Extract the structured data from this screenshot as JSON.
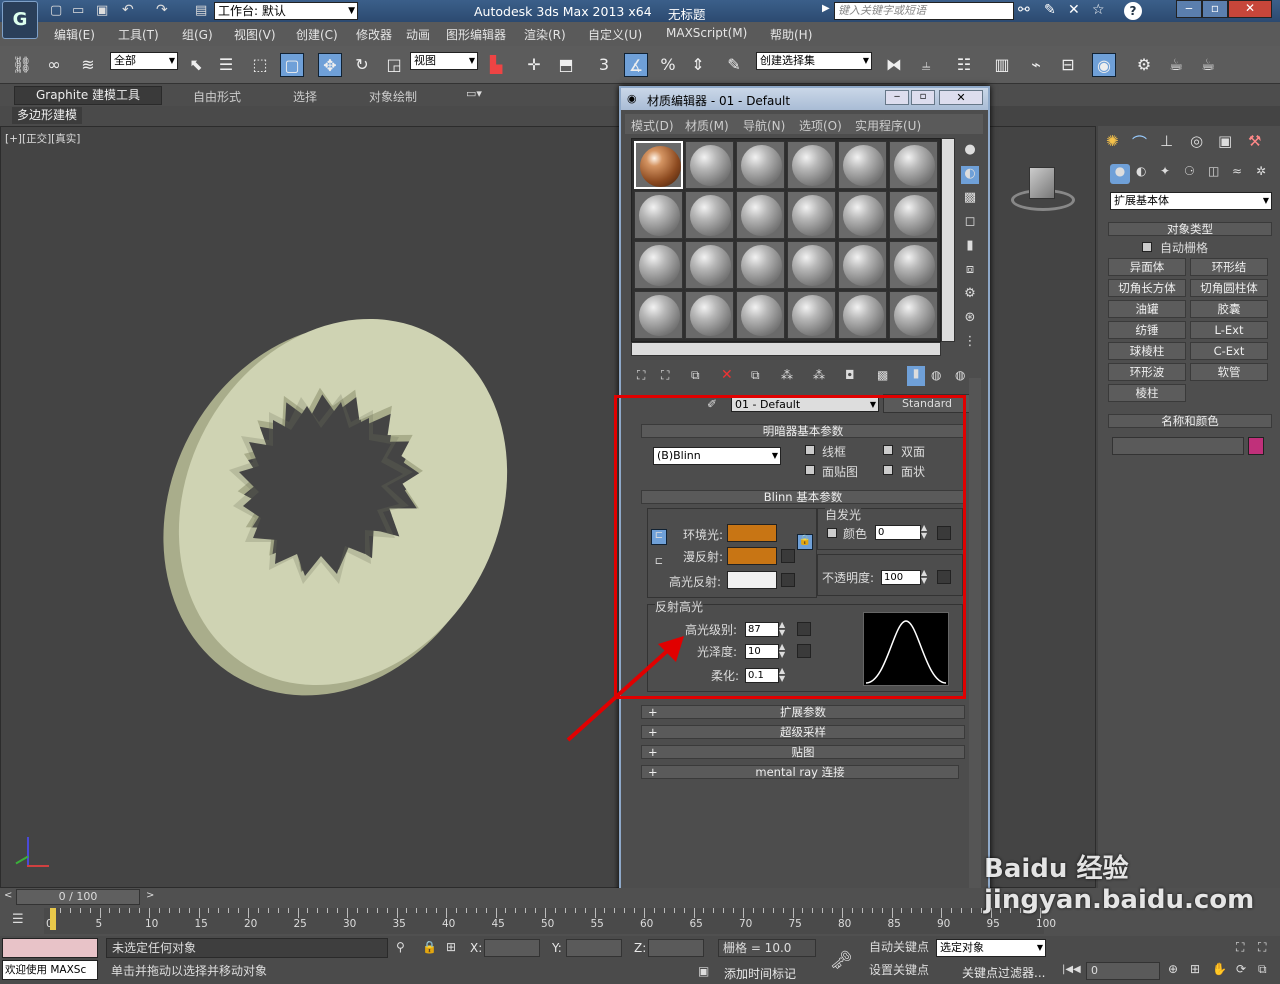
{
  "title_bar": {
    "workspace_label": "工作台: 默认",
    "app_title": "Autodesk 3ds Max  2013 x64",
    "doc_title": "无标题",
    "search_placeholder": "键入关键字或短语"
  },
  "menu": {
    "items": [
      "编辑(E)",
      "工具(T)",
      "组(G)",
      "视图(V)",
      "创建(C)",
      "修改器",
      "动画",
      "图形编辑器",
      "渲染(R)",
      "自定义(U)",
      "MAXScript(M)",
      "帮助(H)"
    ]
  },
  "toolbar": {
    "filter_value": "全部",
    "ref_coord": "视图",
    "selection_set": "创建选择集",
    "snap_label": "3"
  },
  "ribbon": {
    "tabs": [
      "Graphite 建模工具",
      "自由形式",
      "选择",
      "对象绘制"
    ],
    "sub_label": "多边形建模"
  },
  "viewport": {
    "label": "[+][正交][真实]"
  },
  "material_editor": {
    "title": "材质编辑器 - 01 - Default",
    "menu": [
      "模式(D)",
      "材质(M)",
      "导航(N)",
      "选项(O)",
      "实用程序(U)"
    ],
    "material_name": "01 - Default",
    "material_type": "Standard",
    "shader_section": "明暗器基本参数",
    "shader": "(B)Blinn",
    "shader_options": [
      "线框",
      "双面",
      "面贴图",
      "面状"
    ],
    "blinn_section": "Blinn 基本参数",
    "self_illum_label": "自发光",
    "color_label": "颜色",
    "color_value": "0",
    "ambient_label": "环境光:",
    "diffuse_label": "漫反射:",
    "specular_label": "高光反射:",
    "opacity_label": "不透明度:",
    "opacity_value": "100",
    "highlight_section": "反射高光",
    "spec_level_label": "高光级别:",
    "spec_level": "87",
    "gloss_label": "光泽度:",
    "gloss": "10",
    "soften_label": "柔化:",
    "soften": "0.1",
    "rollouts": [
      "扩展参数",
      "超级采样",
      "贴图",
      "mental ray 连接"
    ],
    "colors": {
      "ambient": "#c87514",
      "diffuse": "#c87514",
      "specular": "#f0f0f0"
    }
  },
  "command_panel": {
    "category": "扩展基本体",
    "object_type_title": "对象类型",
    "autogrid": "自动栅格",
    "buttons": [
      "异面体",
      "环形结",
      "切角长方体",
      "切角圆柱体",
      "油罐",
      "胶囊",
      "纺锤",
      "L-Ext",
      "球棱柱",
      "C-Ext",
      "环形波",
      "软管",
      "棱柱"
    ],
    "name_color_title": "名称和颜色",
    "object_color": "#c0307a"
  },
  "timeline": {
    "frame_label": "0 / 100",
    "ticks": [
      "0",
      "5",
      "10",
      "15",
      "20",
      "25",
      "30",
      "35",
      "40",
      "45",
      "50",
      "55",
      "60",
      "65",
      "70",
      "75",
      "80",
      "85",
      "90",
      "95",
      "100"
    ]
  },
  "status": {
    "welcome": "欢迎使用 MAXSc",
    "selection": "未选定任何对象",
    "prompt": "单击并拖动以选择并移动对象",
    "x_label": "X:",
    "y_label": "Y:",
    "z_label": "Z:",
    "grid": "栅格 = 10.0",
    "add_time_tag": "添加时间标记",
    "auto_key": "自动关键点",
    "selected": "选定对象",
    "set_key": "设置关键点",
    "key_filters": "关键点过滤器...",
    "frame_value": "0"
  },
  "watermark": "Baidu 经验 jingyan.baidu.com"
}
